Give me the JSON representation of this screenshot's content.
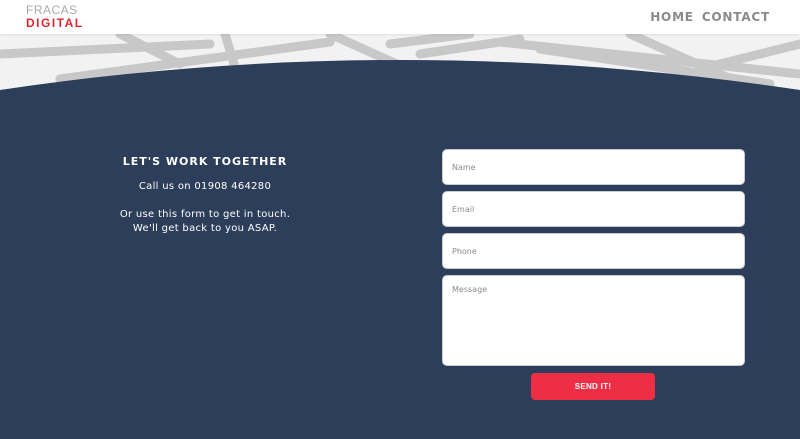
{
  "brand": {
    "line1": "FRACAS",
    "line2": "DIGITAL"
  },
  "nav": {
    "items": [
      {
        "label": "HOME"
      },
      {
        "label": "CONTACT"
      }
    ]
  },
  "intro": {
    "heading": "LET'S WORK TOGETHER",
    "phone_line": "Call us on 01908 464280",
    "form_line1": "Or use this form to get in touch.",
    "form_line2": "We'll get back to you ASAP."
  },
  "form": {
    "name_placeholder": "Name",
    "email_placeholder": "Email",
    "phone_placeholder": "Phone",
    "message_placeholder": "Message",
    "submit_label": "SEND IT!"
  },
  "colors": {
    "background": "#2d3e5a",
    "accent": "#ee2e45",
    "brand_red": "#e0262f",
    "nav_text": "#8a8a8a"
  }
}
